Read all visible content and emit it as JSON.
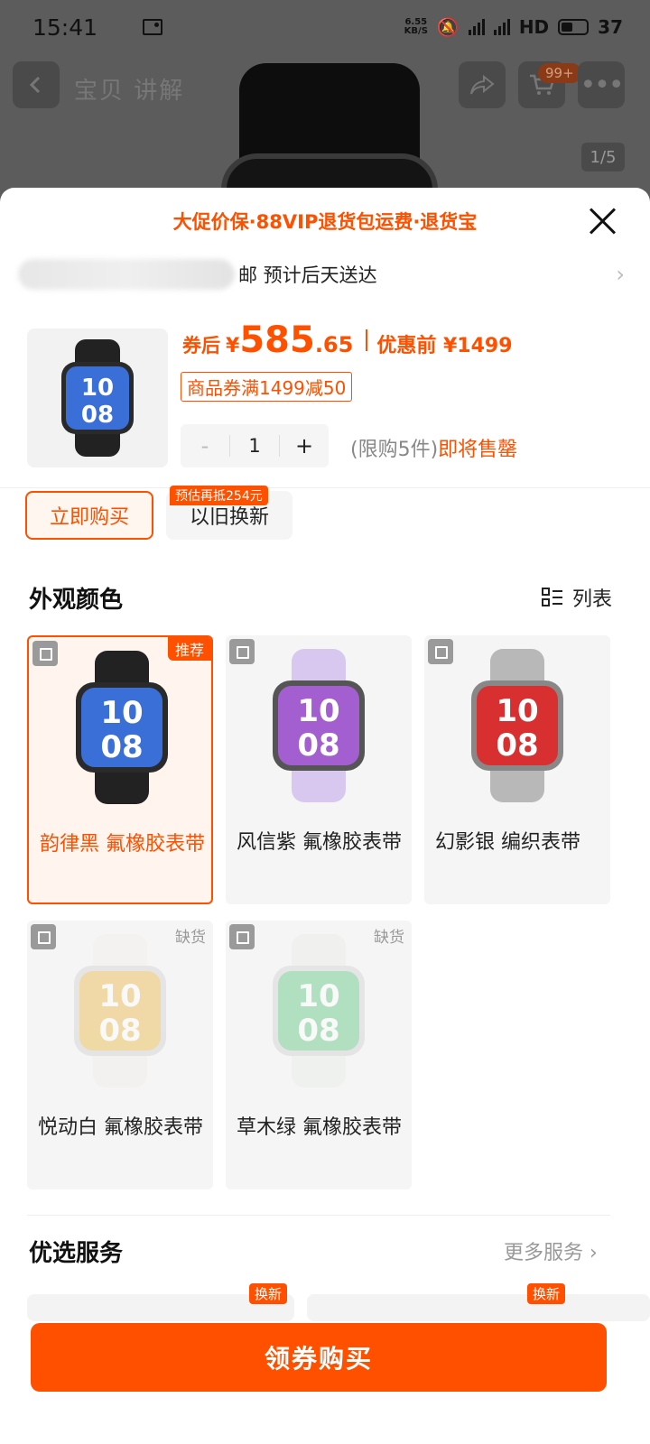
{
  "status": {
    "time": "15:41",
    "speed_top": "6.55",
    "speed_bottom": "KB/S",
    "net1": "4G",
    "net2": "4G",
    "hd": "HD",
    "battery": "37"
  },
  "background": {
    "tab_label": "宝贝 讲解",
    "cart_badge": "99+",
    "page_indicator": "1/5"
  },
  "sheet": {
    "promo_line": "大促价保·88VIP退货包运费·退货宝",
    "address": {
      "text": "邮 预计后天送达",
      "arrow": "›"
    },
    "price": {
      "prefix": "券后",
      "currency": "¥",
      "integer": "585",
      "decimal": ".65",
      "original": "优惠前 ¥1499"
    },
    "coupon": "商品券满1499减50",
    "quantity": {
      "minus": "-",
      "value": "1",
      "plus": "+"
    },
    "limit": {
      "gray": "(限购5件)",
      "orange": "即将售罄"
    },
    "actions": {
      "buy_now": "立即购买",
      "trade_in": "以旧换新",
      "trade_badge": "预估再抵254元"
    },
    "color_section": {
      "title": "外观颜色",
      "list_toggle": "列表",
      "options": [
        {
          "label": "韵律黑 氟橡胶表带",
          "tag": "推荐",
          "selected": true,
          "band": "#222222",
          "face": "#3a6fd8",
          "frame": "#2a2a2a"
        },
        {
          "label": "风信紫 氟橡胶表带",
          "tag": "",
          "selected": false,
          "band": "#d8c8ef",
          "face": "#a35ed0",
          "frame": "#555555"
        },
        {
          "label": "幻影银 编织表带",
          "tag": "",
          "selected": false,
          "band": "#b8b8b8",
          "face": "#d83030",
          "frame": "#888888"
        },
        {
          "label": "悦动白 氟橡胶表带",
          "tag": "缺货",
          "selected": false,
          "band": "#f0ede8",
          "face": "#e8b030",
          "frame": "#cccccc"
        },
        {
          "label": "草木绿 氟橡胶表带",
          "tag": "缺货",
          "selected": false,
          "band": "#e8ece4",
          "face": "#4cc070",
          "frame": "#cccccc"
        }
      ]
    },
    "services": {
      "title": "优选服务",
      "more": "更多服务 ›",
      "badges": [
        "换新",
        "换新"
      ]
    },
    "cta": "领券购买"
  },
  "colors": {
    "accent": "#ff5000"
  }
}
